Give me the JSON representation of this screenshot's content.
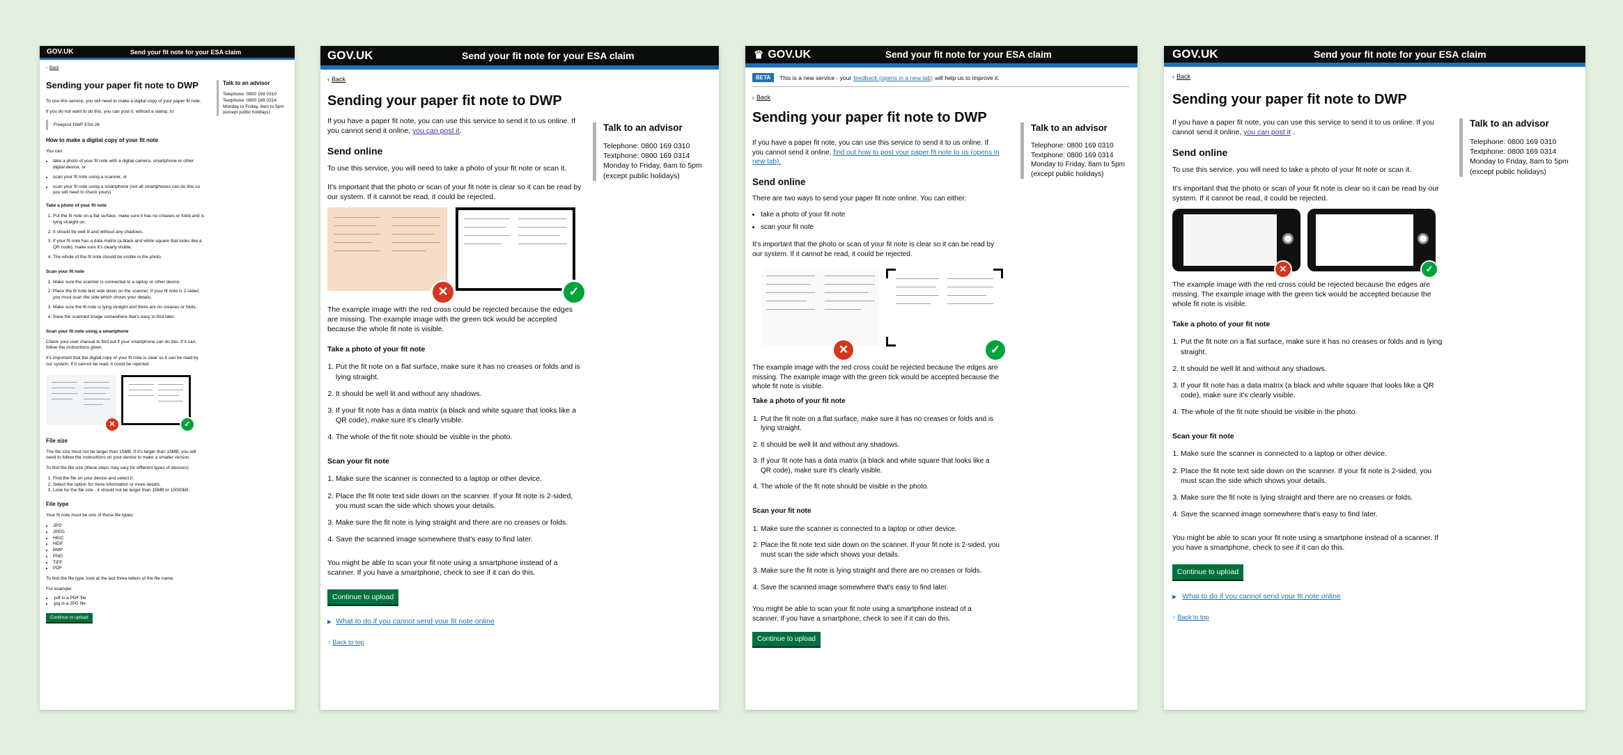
{
  "header": {
    "logo": "GOV.UK",
    "service": "Send your fit note for your ESA claim"
  },
  "back": "Back",
  "title": "Sending your paper fit note to DWP",
  "sidebar": {
    "title": "Talk to an advisor",
    "telephone": "Telephone: 0800 169 0310",
    "textphone": "Textphone: 0800 169 0314",
    "hours": "Monday to Friday, 8am to 5pm",
    "hours_note": "(except public holidays)"
  },
  "colors": {
    "brand_blue": "#1d70b8",
    "button_green": "#00703c",
    "error_red": "#d4351c",
    "success_green": "#00a33b",
    "header_black": "#0b0c0c",
    "background": "#e3f0df"
  },
  "icons": {
    "bad": "cross-icon",
    "good": "tick-icon",
    "back": "chevron-left-icon",
    "details": "triangle-right-icon",
    "top": "arrow-up-icon"
  },
  "v1": {
    "intro1": "To use this service, you will need to make a digital copy of your paper fit note.",
    "intro2": "If you do not want to do this, you can post it, without a stamp, to:",
    "address": "Freepost DWP ESA 26",
    "h_make": "How to make a digital copy of your fit note",
    "you_can": "You can:",
    "make_options": [
      "take a photo of your fit note with a digital camera, smartphone or other digital device, or",
      "scan your fit note using a scanner, or",
      "scan your fit note using a smartphone (not all smartphones can do this so you will need to check yours)"
    ],
    "h_photo": "Take a photo of your fit note",
    "photo_steps": [
      "Put the fit note on a flat surface, make sure it has no creases or folds and is lying straight on.",
      "It should be well lit and without any shadows.",
      "If your fit note has a data matrix (a black and white square that looks like a QR code), make sure it's clearly visible.",
      "The whole of the fit note should be visible in the photo."
    ],
    "h_scan": "Scan your fit note",
    "scan_steps": [
      "Make sure the scanner is connected to a laptop or other device.",
      "Place the fit note text side down on the scanner. If your fit note is 2-sided, you must scan the side which shows your details.",
      "Make sure the fit note is lying straight and there are no creases or folds.",
      "Save the scanned image somewhere that's easy to find later."
    ],
    "h_smart": "Scan your fit note using a smartphone",
    "smart_p1": "Check your user manual to find out if your smartphone can do this. If it can, follow the instructions given.",
    "smart_p2": "It's important that the digital copy of your fit note is clear so it can be read by our system. If it cannot be read, it could be rejected.",
    "h_size": "File size",
    "size_p1": "The file size must not be larger than 15MB. If it's larger than 15MB, you will need to follow the instructions on your device to make a smaller version.",
    "size_p2": "To find the file size (these steps may vary for different types of devices):",
    "size_steps": [
      "Find the file on your device and select it.",
      "Select the option for more information or more details.",
      "Look for the file size - it should not be larger than 15MB or 15000kB."
    ],
    "h_type": "File type",
    "type_p": "Your fit note must be one of these file types:",
    "types": [
      "JPG",
      "JPEG",
      "HEIC",
      "HEIF",
      "BMP",
      "PNG",
      "TIFF",
      "PDF"
    ],
    "type_p2": "To find the file type, look at the last three letters of the file name.",
    "example": "For example:",
    "examples": [
      ".pdf is a PDF file",
      ".jpg is a JPG file"
    ],
    "button": "Continue to upload"
  },
  "v2": {
    "intro": "If you have a paper fit note, you can use this service to send it to us online. If you cannot send it online,",
    "intro_link": "you can post it",
    "h_online": "Send online",
    "online_p": "To use this service, you will need to take a photo of your fit note or scan it.",
    "important": "It's important that the photo or scan of your fit note is clear so it can be read by our system. If it cannot be read, it could be rejected.",
    "caption": "The example image with the red cross could be rejected because the edges are missing. The example image with the green tick would be accepted because the whole fit note is visible.",
    "h_photo": "Take a photo of your fit note",
    "photo_steps": [
      "Put the fit note on a flat surface, make sure it has no creases or folds and is lying straight.",
      "It should be well lit and without any shadows.",
      "If your fit note has a data matrix (a black and white square that looks like a QR code), make sure it's clearly visible.",
      "The whole of the fit note should be visible in the photo."
    ],
    "h_scan": "Scan your fit note",
    "scan_steps": [
      "Make sure the scanner is connected to a laptop or other device.",
      "Place the fit note text side down on the scanner. If your fit note is 2-sided, you must scan the side which shows your details.",
      "Make sure the fit note is lying straight and there are no creases or folds.",
      "Save the scanned image somewhere that's easy to find later."
    ],
    "smartphone": "You might be able to scan your fit note using a smartphone instead of a scanner. If you have a smartphone, check to see if it can do this.",
    "button": "Continue to upload",
    "details": "What to do if you cannot send your fit note online",
    "top": "Back to top"
  },
  "v3": {
    "beta_tag": "BETA",
    "beta_text": "This is a new service - your",
    "beta_link": "feedback (opens in a new tab)",
    "beta_after": "will help us to improve it.",
    "intro": "If you have a paper fit note, you can use this service to send it to us online. If you cannot send it online,",
    "intro_link": "find out how to post your paper fit note to us (opens in new tab).",
    "h_online": "Send online",
    "ways": "There are two ways to send your paper fit note online. You can either:",
    "ways_list": [
      "take a photo of your fit note",
      "scan your fit note"
    ],
    "important": "It's important that the photo or scan of your fit note is clear so it can be read by our system. If it cannot be read, it could be rejected.",
    "caption": "The example image with the red cross could be rejected because the edges are missing. The example image with the green tick would be accepted because the whole fit note is visible.",
    "h_photo": "Take a photo of your fit note",
    "photo_steps": [
      "Put the fit note on a flat surface, make sure it has no creases or folds and is lying straight.",
      "It should be well lit and without any shadows.",
      "If your fit note has a data matrix (a black and white square that looks like a QR code), make sure it's clearly visible.",
      "The whole of the fit note should be visible in the photo."
    ],
    "h_scan": "Scan your fit note",
    "scan_steps": [
      "Make sure the scanner is connected to a laptop or other device.",
      "Place the fit note text side down on the scanner. If your fit note is 2-sided, you must scan the side which shows your details.",
      "Make sure the fit note is lying straight and there are no creases or folds.",
      "Save the scanned image somewhere that's easy to find later."
    ],
    "smartphone": "You might be able to scan your fit note using a smartphone instead of a scanner. If you have a smartphone, check to see if it can do this.",
    "button": "Continue to upload"
  },
  "v4": {
    "intro": "If you have a paper fit note, you can use this service to send it to us online. If you cannot send it online,",
    "intro_link": "you can post it",
    "h_online": "Send online",
    "online_p": "To use this service, you will need to take a photo of your fit note or scan it.",
    "important": "It's important that the photo or scan of your fit note is clear so it can be read by our system. If it cannot be read, it could be rejected.",
    "caption": "The example image with the red cross could be rejected because the edges are missing. The example image with the green tick would be accepted because the whole fit note is visible.",
    "h_photo": "Take a photo of your fit note",
    "photo_steps": [
      "Put the fit note on a flat surface, make sure it has no creases or folds and is lying straight.",
      "It should be well lit and without any shadows.",
      "If your fit note has a data matrix (a black and white square that looks like a QR code), make sure it's clearly visible.",
      "The whole of the fit note should be visible in the photo."
    ],
    "h_scan": "Scan your fit note",
    "scan_steps": [
      "Make sure the scanner is connected to a laptop or other device.",
      "Place the fit note text side down on the scanner. If your fit note is 2-sided, you must scan the side which shows your details.",
      "Make sure the fit note is lying straight and there are no creases or folds.",
      "Save the scanned image somewhere that's easy to find later."
    ],
    "smartphone": "You might be able to scan your fit note using a smartphone instead of a scanner. If you have a smartphone, check to see if it can do this.",
    "button": "Continue to upload",
    "details": "What to do if you cannot send your fit note online",
    "top": "Back to top"
  }
}
